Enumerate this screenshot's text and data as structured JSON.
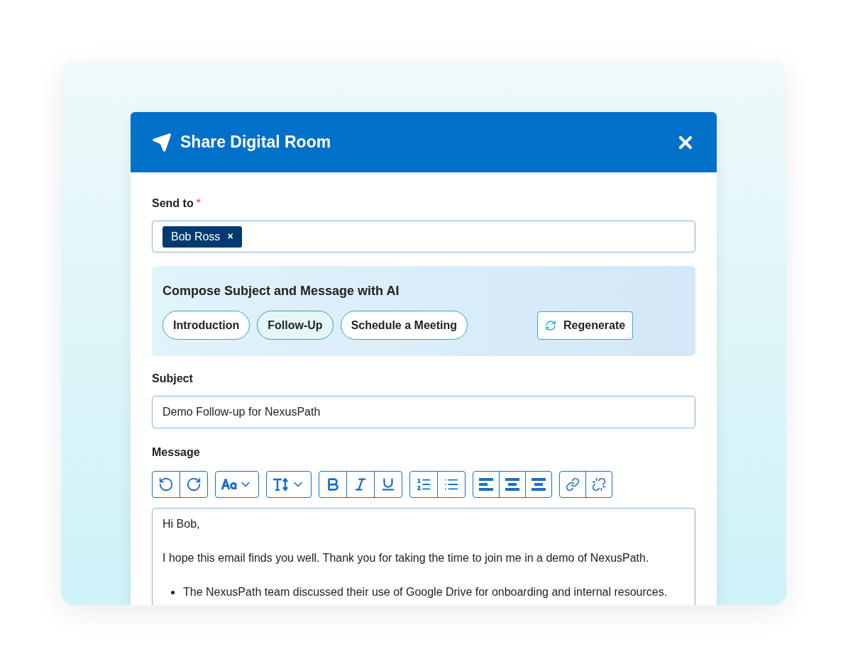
{
  "dialog": {
    "title": "Share Digital Room"
  },
  "send_to": {
    "label": "Send to",
    "required_mark": "*",
    "recipients": [
      {
        "name": "Bob Ross",
        "remove": "×"
      }
    ]
  },
  "ai_panel": {
    "title": "Compose Subject and Message with AI",
    "options": [
      {
        "label": "Introduction",
        "selected": false
      },
      {
        "label": "Follow-Up",
        "selected": true
      },
      {
        "label": "Schedule a Meeting",
        "selected": false
      }
    ],
    "regenerate": "Regenerate"
  },
  "subject": {
    "label": "Subject",
    "value": "Demo Follow-up for NexusPath"
  },
  "message": {
    "label": "Message",
    "body": [
      {
        "kind": "paragraph",
        "text": "Hi Bob,"
      },
      {
        "kind": "paragraph",
        "text": "I hope this email finds you well. Thank you for taking the time to join me in a demo of NexusPath."
      },
      {
        "kind": "bullet",
        "text": "The NexusPath team discussed their use of Google Drive for onboarding and internal resources."
      }
    ]
  }
}
